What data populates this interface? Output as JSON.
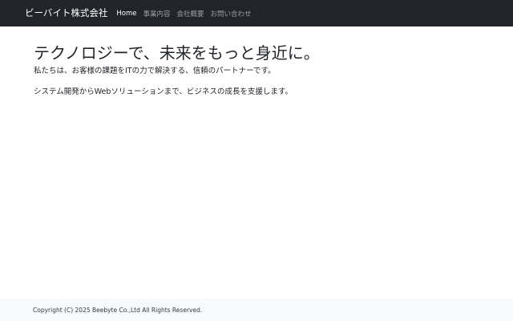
{
  "navbar": {
    "brand": "ビーバイト株式会社",
    "links": [
      {
        "label": "Home",
        "active": true
      },
      {
        "label": "事業内容",
        "active": false
      },
      {
        "label": "会社概要",
        "active": false
      },
      {
        "label": "お問い合わせ",
        "active": false
      }
    ]
  },
  "main": {
    "headline": "テクノロジーで、未来をもっと身近に。",
    "paragraphs": [
      "私たちは、お客様の課題をITの力で解決する、信頼のパートナーです。",
      "システム開発からWebソリューションまで、ビジネスの成長を支援します。"
    ]
  },
  "footer": {
    "copyright": "Copyright (C) 2025 Beebyte Co.,Ltd All Rights Reserved."
  },
  "colors": {
    "navbar_bg": "#212529",
    "footer_bg": "#f8f9fa",
    "nav_active": "#ffffff",
    "nav_inactive": "#9a9da0"
  }
}
